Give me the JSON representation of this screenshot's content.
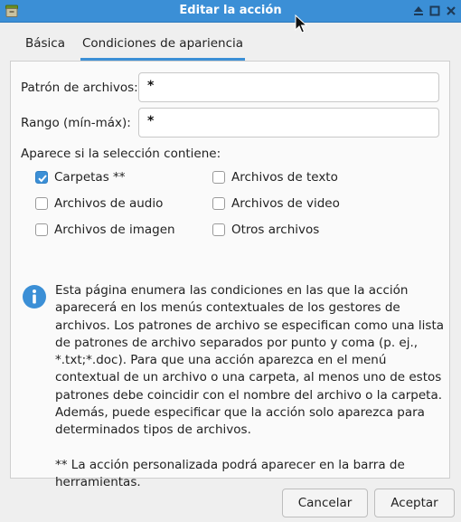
{
  "window": {
    "title": "Editar la acción"
  },
  "icons": {
    "app": "app-drawer-icon",
    "eject": "eject-icon",
    "maximize": "maximize-icon",
    "close": "close-icon",
    "info": "info-icon",
    "cursor": "mouse-pointer-icon"
  },
  "colors": {
    "accent": "#3b8fd6"
  },
  "tabs": [
    {
      "label": "Básica",
      "active": false
    },
    {
      "label": "Condiciones de apariencia",
      "active": true
    }
  ],
  "form": {
    "patron_label": "Patrón de archivos:",
    "patron_value": "*",
    "rango_label": "Rango (mín-máx):",
    "rango_value": "*"
  },
  "selection": {
    "label": "Aparece si la selección contiene:",
    "options": [
      {
        "label": "Carpetas **",
        "checked": true
      },
      {
        "label": "Archivos de texto",
        "checked": false
      },
      {
        "label": "Archivos de audio",
        "checked": false
      },
      {
        "label": "Archivos de video",
        "checked": false
      },
      {
        "label": "Archivos de imagen",
        "checked": false
      },
      {
        "label": "Otros archivos",
        "checked": false
      }
    ]
  },
  "info": {
    "paragraph": "Esta página enumera las condiciones en las que la acción aparecerá en los menús contextuales de los gestores de archivos. Los patrones de archivo se especifican como una lista de patrones de archivo separados por punto y coma (p. ej., *.txt;*.doc). Para que una acción aparezca en el menú contextual de un archivo o una carpeta, al menos uno de estos patrones debe coincidir con el nombre del archivo o la carpeta. Además, puede especificar que la acción solo aparezca para determinados tipos de archivos.",
    "note": "** La acción personalizada podrá aparecer en la barra de herramientas."
  },
  "buttons": {
    "cancel": "Cancelar",
    "accept": "Aceptar"
  }
}
